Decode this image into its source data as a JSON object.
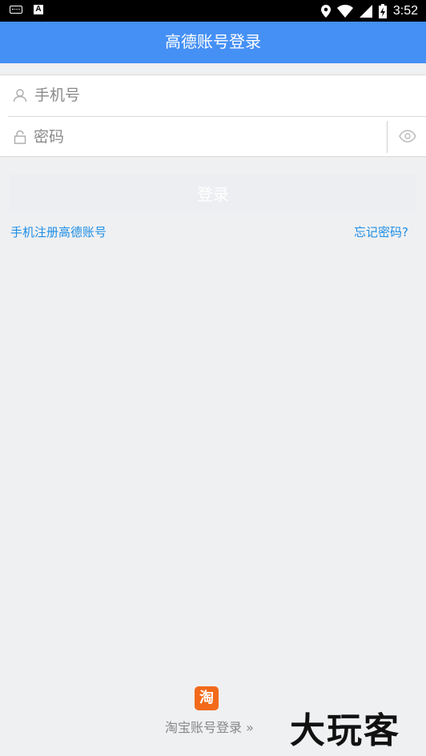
{
  "status_bar": {
    "time": "3:52",
    "a_badge": "A"
  },
  "header": {
    "title": "高德账号登录"
  },
  "form": {
    "phone_placeholder": "手机号",
    "password_placeholder": "密码"
  },
  "login_button": "登录",
  "links": {
    "register": "手机注册高德账号",
    "forgot": "忘记密码?"
  },
  "taobao": {
    "icon_text": "淘",
    "label": "淘宝账号登录 »"
  },
  "watermark": "大玩客",
  "colors": {
    "app_bar": "#4590f5",
    "link": "#1e8ee6",
    "taobao": "#f26a1a"
  }
}
